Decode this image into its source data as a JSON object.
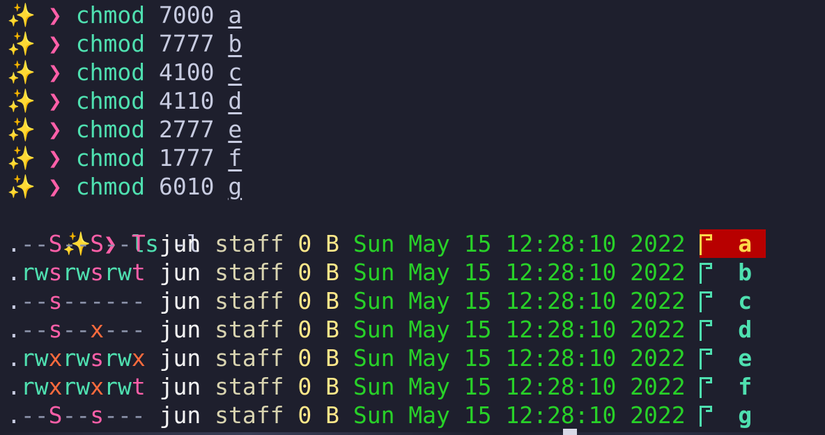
{
  "prompt": {
    "sparkle": "✨",
    "arrow": "❯"
  },
  "commands": [
    {
      "cmd": "chmod",
      "arg": "7000",
      "target": "a"
    },
    {
      "cmd": "chmod",
      "arg": "7777",
      "target": "b"
    },
    {
      "cmd": "chmod",
      "arg": "4100",
      "target": "c"
    },
    {
      "cmd": "chmod",
      "arg": "4110",
      "target": "d"
    },
    {
      "cmd": "chmod",
      "arg": "2777",
      "target": "e"
    },
    {
      "cmd": "chmod",
      "arg": "1777",
      "target": "f"
    },
    {
      "cmd": "chmod",
      "arg": "6010",
      "target": "g"
    }
  ],
  "ls_command": {
    "cmd": "ls",
    "arg": "-l"
  },
  "listing": [
    {
      "perm_dot": ".",
      "perms": "--S--S--T",
      "user": "jun",
      "group": "staff",
      "size": "0",
      "unit": "B",
      "date": "Sun May 15 12:28:10 2022",
      "name": "a",
      "highlighted": true
    },
    {
      "perm_dot": ".",
      "perms": "rwsrwsrwt",
      "user": "jun",
      "group": "staff",
      "size": "0",
      "unit": "B",
      "date": "Sun May 15 12:28:10 2022",
      "name": "b",
      "highlighted": false
    },
    {
      "perm_dot": ".",
      "perms": "--s------",
      "user": "jun",
      "group": "staff",
      "size": "0",
      "unit": "B",
      "date": "Sun May 15 12:28:10 2022",
      "name": "c",
      "highlighted": false
    },
    {
      "perm_dot": ".",
      "perms": "--s--x---",
      "user": "jun",
      "group": "staff",
      "size": "0",
      "unit": "B",
      "date": "Sun May 15 12:28:10 2022",
      "name": "d",
      "highlighted": false
    },
    {
      "perm_dot": ".",
      "perms": "rwxrwsrwx",
      "user": "jun",
      "group": "staff",
      "size": "0",
      "unit": "B",
      "date": "Sun May 15 12:28:10 2022",
      "name": "e",
      "highlighted": false
    },
    {
      "perm_dot": ".",
      "perms": "rwxrwxrwt",
      "user": "jun",
      "group": "staff",
      "size": "0",
      "unit": "B",
      "date": "Sun May 15 12:28:10 2022",
      "name": "f",
      "highlighted": false
    },
    {
      "perm_dot": ".",
      "perms": "--S--s---",
      "user": "jun",
      "group": "staff",
      "size": "0",
      "unit": "B",
      "date": "Sun May 15 12:28:10 2022",
      "name": "g",
      "highlighted": false
    }
  ],
  "icons": {
    "file": "file-icon",
    "sparkle": "sparkle-icon",
    "prompt_arrow": "chevron-right-icon"
  },
  "colors": {
    "background": "#1e1f2d",
    "command": "#4fe0b0",
    "arrow": "#ff5fa8",
    "date": "#28d128",
    "highlight_bg": "#b80000",
    "highlight_fg": "#ffd84a"
  }
}
